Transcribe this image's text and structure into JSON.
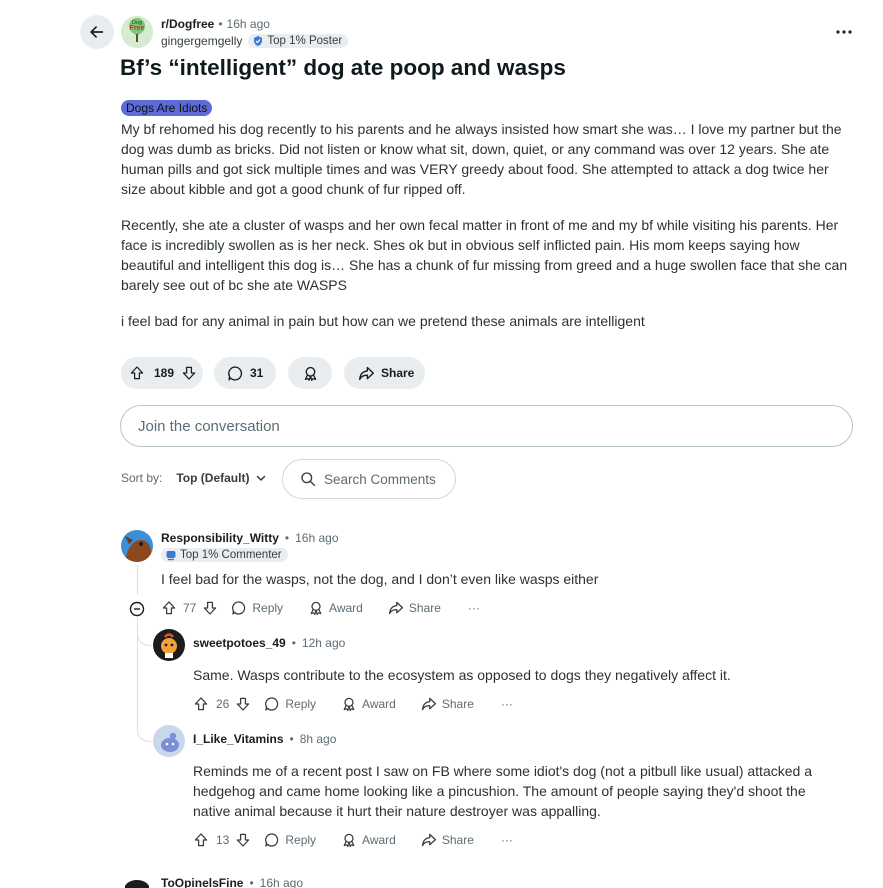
{
  "header": {
    "subreddit": "r/Dogfree",
    "post_age": "16h ago",
    "author": "gingergemgelly",
    "author_flair": "Top 1% Poster",
    "avatar_text": "Free",
    "avatar_small_text": "Dog"
  },
  "post": {
    "title": "Bf’s “intelligent” dog ate poop and wasps",
    "flair": "Dogs Are Idiots",
    "paragraphs": [
      "My bf rehomed his dog recently to his parents and he always insisted how smart she was… I love my partner but the dog was dumb as bricks. Did not listen or know what sit, down, quiet, or any command was over 12 years. She ate human pills and got sick multiple times and was VERY greedy about food. She attempted to attack a dog twice her size about kibble and got a good chunk of fur ripped off.",
      "Recently, she ate a cluster of wasps and her own fecal matter in front of me and my bf while visiting his parents. Her face is incredibly swollen as is her neck. Shes ok but in obvious self inflicted pain. His mom keeps saying how beautiful and intelligent this dog is… She has a chunk of fur missing from greed and a huge swollen face that she can barely see out of bc she ate WASPS",
      "i feel bad for any animal in pain but how can we pretend these animals are intelligent"
    ],
    "votes": "189",
    "comments": "31",
    "share_label": "Share"
  },
  "join_placeholder": "Join the conversation",
  "sort": {
    "label": "Sort by:",
    "value": "Top (Default)"
  },
  "search_comments": "Search Comments",
  "actions": {
    "reply": "Reply",
    "award": "Award",
    "share": "Share",
    "more": "···"
  },
  "comments": [
    {
      "author": "Responsibility_Witty",
      "age": "16h ago",
      "flair": "Top 1% Commenter",
      "text": "I feel bad for the wasps, not the dog, and I don’t even like wasps either",
      "votes": "77"
    },
    {
      "author": "sweetpotoes_49",
      "age": "12h ago",
      "text": "Same. Wasps contribute to the ecosystem as opposed to dogs they negatively affect it.",
      "votes": "26"
    },
    {
      "author": "I_Like_Vitamins",
      "age": "8h ago",
      "text": "Reminds me of a recent post I saw on FB where some idiot's dog (not a pitbull like usual) attacked a hedgehog and came home looking like a pincushion. The amount of people saying they'd shoot the native animal because it hurt their nature destroyer was appalling.",
      "votes": "13"
    },
    {
      "author": "ToOpinelsFine",
      "age": "16h ago"
    }
  ],
  "meta_separator": "•",
  "icons": {
    "back": "arrow-left-icon",
    "more": "ellipsis-icon",
    "upvote": "arrow-up-icon",
    "downvote": "arrow-down-icon",
    "comment": "speech-bubble-icon",
    "award": "award-icon",
    "share": "share-arrow-icon",
    "search": "search-icon",
    "collapse": "minus-circle-icon"
  },
  "colors": {
    "flair_bg": "#5c6bd6",
    "pill_bg": "#eaedef",
    "text": "#1c1c1c",
    "muted": "#5c6c74"
  }
}
